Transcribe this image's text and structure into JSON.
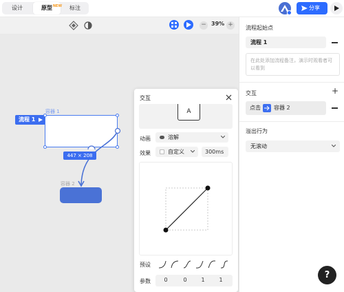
{
  "topbar": {
    "modes": [
      "设计",
      "原型",
      "标注"
    ],
    "active_mode": "原型",
    "new_badge": "NEW",
    "share_label": "分享"
  },
  "canvas": {
    "zoom": "39%",
    "zoom_minus": "−",
    "zoom_plus": "+",
    "flow_tag": "流程 1",
    "container1_label": "容器 1",
    "container2_label": "容器 2",
    "dimension": "447 × 208"
  },
  "popover": {
    "title": "交互",
    "preview_text": "A",
    "animation_label": "动画",
    "animation_value": "溶解",
    "effect_label": "效果",
    "effect_value": "自定义",
    "duration": "300ms",
    "preset_label": "预设",
    "param_label": "参数",
    "params": [
      "0",
      "0",
      "1",
      "1"
    ]
  },
  "panel": {
    "flow_start_title": "流程起始点",
    "flow_name": "流程 1",
    "note_placeholder": "在此处添加流程备注，演示时观看者可以看到",
    "interaction_title": "交互",
    "interaction_trigger": "点击",
    "interaction_target": "容器 2",
    "overflow_title": "溢出行为",
    "overflow_value": "无滚动"
  },
  "help": {
    "label": "?"
  },
  "colors": {
    "accent": "#2d6cff",
    "container_fill": "#4a72d6",
    "canvas_bg": "#eaeaea"
  }
}
